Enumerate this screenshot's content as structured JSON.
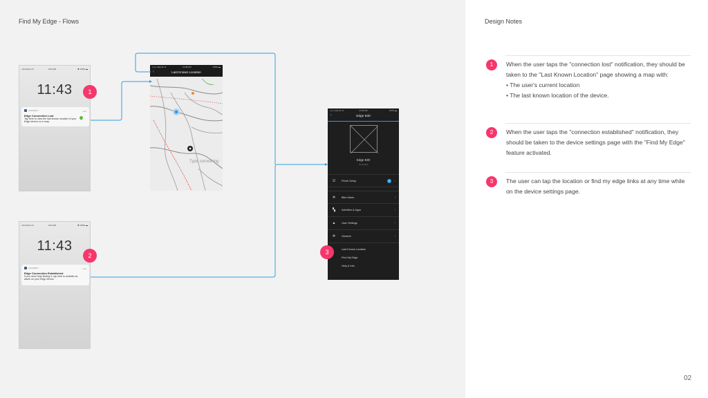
{
  "canvas": {
    "title": "Find My Edge - Flows"
  },
  "phone_lost": {
    "status": {
      "carrier": "••Ⅱ Verizon ≋",
      "time": "9:41 AM",
      "battery": "✱ 100% ▬"
    },
    "lock_time": "11:43",
    "notification": {
      "app": "CONNECT",
      "time": "now",
      "title": "Edge Connection Lost",
      "body": "Tap here to view the last known location of your Edge device on a map."
    }
  },
  "phone_established": {
    "status": {
      "carrier": "••Ⅱ Verizon ≋",
      "time": "9:41 AM",
      "battery": "✱ 100% ▬"
    },
    "lock_time": "11:43",
    "notification": {
      "app": "CONNECT",
      "time": "now",
      "title": "Edge Connection Established",
      "body": "If you need help finding it, tap here to activate an alarm on your Edge device."
    }
  },
  "map_screen": {
    "status": {
      "carrier": "•••••• Garmin ≋",
      "time": "11:08 AM",
      "battery": "100% ▬"
    },
    "title": "Last Known Location",
    "placeholder_text": "Type something"
  },
  "settings_screen": {
    "status": {
      "carrier": "•••••• Garmin ≋",
      "time": "11:08 AM",
      "battery": "100% ▬"
    },
    "title": "Edge 830",
    "device_name": "Edge 830",
    "device_status": "Connected",
    "finish_setup": {
      "label": "Finish Setup",
      "badge": "2"
    },
    "menu": [
      {
        "label": "Bike Alarm",
        "icon": "gear-icon"
      },
      {
        "label": "Activities & Apps",
        "icon": "grid-icon"
      },
      {
        "label": "User Settings",
        "icon": "user-icon"
      },
      {
        "label": "General",
        "icon": "gear-icon"
      }
    ],
    "links": [
      "Last Known Location",
      "Find My Edge",
      "Help & Info"
    ]
  },
  "badges": {
    "one": "1",
    "two": "2",
    "three": "3"
  },
  "notes_panel": {
    "title": "Design Notes",
    "notes": [
      {
        "number": "1",
        "text": "When the user taps the \"connection lost\" notification, they should be taken to the \"Last Known Location\" page showing a map with:",
        "bullets": [
          "• The user's current location",
          "• The last known location of the device."
        ]
      },
      {
        "number": "2",
        "text": "When the user taps the \"connection established\" notification, they should be taken to the device settings page with the \"Find My Edge\" feature activated."
      },
      {
        "number": "3",
        "text": "The user can tap the location or find my edge links at any time while on the device settings page."
      }
    ],
    "page_number": "02"
  },
  "colors": {
    "accent_pink": "#f5376b",
    "flow_blue": "#2f9fe0",
    "dark_screen": "#1e1e1e"
  }
}
